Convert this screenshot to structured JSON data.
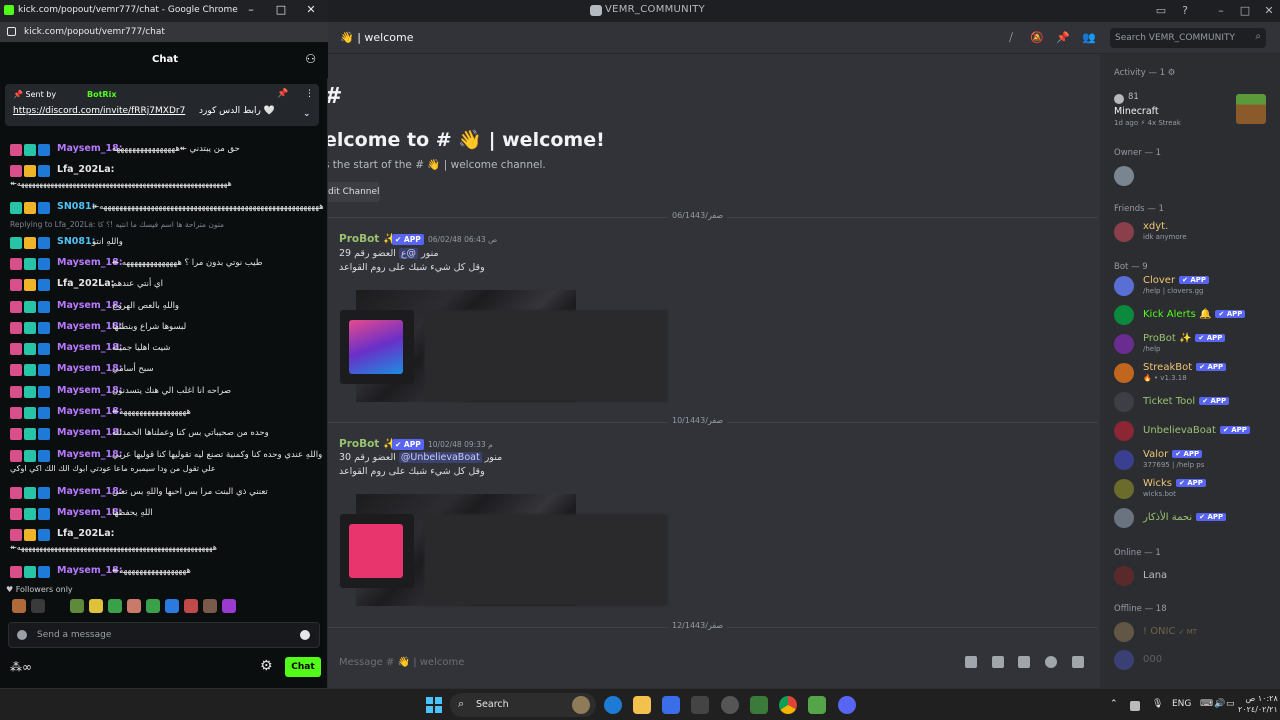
{
  "discord": {
    "window_title": "VEMR_COMMUNITY",
    "channel_header": "👋 | welcome",
    "search_placeholder": "Search VEMR_COMMUNITY",
    "welcome_title": "elcome to # 👋 | welcome!",
    "welcome_sub": "s the start of the # 👋 | welcome channel.",
    "edit_channel": "dit Channel",
    "dates": [
      "06/1443/صفر",
      "10/1443/صفر",
      "12/1443/صفر"
    ],
    "messages": [
      {
        "author": "ProBot ✨",
        "badge": "✔ APP",
        "time": "06/02/48 06:43 ص",
        "line1_prefix": "@ع",
        "line1": "العضو رقم 29",
        "line1_tail": "منور",
        "line2": "وقل كل شيء شبك على روم القواعد"
      },
      {
        "author": "ProBot ✨",
        "badge": "✔ APP",
        "time": "10/02/48 09:33 م",
        "line1": "العضو رقم 30",
        "mention": "@UnbelievaBoat",
        "line1_tail": "منور",
        "line2": "وقل كل شيء شبك على روم القواعد"
      }
    ],
    "composer_placeholder": "Message # 👋 | welcome",
    "members": {
      "activity_header": "Activity — 1 ⚙",
      "activity": {
        "count": "81",
        "game": "Minecraft",
        "meta": "1d ago",
        "streak": "⚡ 4x Streak"
      },
      "owner_header": "Owner — 1",
      "friends_header": "Friends — 1",
      "friend": {
        "name": "xdyt.",
        "status": "idk anymore"
      },
      "bot_header": "Bot — 9",
      "bots": [
        {
          "name": "Clover",
          "status": "/help | clovers.gg",
          "color": "#f0c674",
          "badge": "✔ APP"
        },
        {
          "name": "Kick Alerts 🔔",
          "status": "",
          "color": "#53fc18",
          "badge": "✔ APP"
        },
        {
          "name": "ProBot ✨",
          "status": "/help",
          "color": "#9ac26e",
          "badge": "✔ APP"
        },
        {
          "name": "StreakBot",
          "status": "🔥 • v1.3.18",
          "color": "#f0c674",
          "badge": "✔ APP"
        },
        {
          "name": "Ticket Tool",
          "status": "",
          "color": "#9ac26e",
          "badge": "✔ APP"
        },
        {
          "name": "UnbelievaBoat",
          "status": "",
          "color": "#9ac26e",
          "badge": "✔ APP"
        },
        {
          "name": "Valor",
          "status": "377695 | /help ps",
          "color": "#f0c674",
          "badge": "✔ APP"
        },
        {
          "name": "Wicks",
          "status": "wicks.bot",
          "color": "#f0c674",
          "badge": "✔ APP"
        },
        {
          "name": "نحمة الأذكار",
          "status": "",
          "color": "#9ac26e",
          "badge": "✔ APP"
        }
      ],
      "online_header": "Online — 1",
      "online": [
        {
          "name": "Lana"
        }
      ],
      "offline_header": "Offline — 18",
      "offline": [
        {
          "name": "! ONIC",
          "tag": "✓ MT"
        },
        {
          "name": "000"
        }
      ]
    }
  },
  "chrome": {
    "window_title": "kick.com/popout/vemr777/chat - Google Chrome",
    "url": "kick.com/popout/vemr777/chat"
  },
  "kick": {
    "header": "Chat",
    "pinned": {
      "sent_by": "Sent by",
      "bot": "BotRix",
      "link": "https://discord.com/invite/fRRj7MXDr7",
      "text": "رابط الدس كورد 🤍"
    },
    "messages": [
      {
        "user": "Maysem_18:",
        "color": "#b779ff",
        "text": "حق من يبتدني ↞ههههههههههههههههه"
      },
      {
        "user": "Lfa_202La:",
        "color": "#e6e6e6",
        "text": "",
        "line2": "↞هههههههههههههههههههههههههههههههههههههههههههههههههههههههههه"
      },
      {
        "user": "SN081:",
        "color": "#4fc3f7",
        "text": "↞ههههههههههههههههههههههههههههههههههههههههههههههههههههههههه"
      },
      {
        "user": "SN081:",
        "color": "#4fc3f7",
        "text": "واللهِ انتو"
      },
      {
        "user": "Maysem_18:",
        "color": "#b779ff",
        "text": "↞ طيب نوتي بدون مرا ؟ ههههههههههههههه"
      },
      {
        "user": "Lfa_202La:",
        "color": "#e6e6e6",
        "text": "اي أنتي عندهم"
      },
      {
        "user": "Maysem_18:",
        "color": "#b779ff",
        "text": "واللهِ بالعص الهروج"
      },
      {
        "user": "Maysem_18:",
        "color": "#b779ff",
        "text": "لبسوها شراع وبنطلها"
      },
      {
        "user": "Maysem_18:",
        "color": "#b779ff",
        "text": "شيت اهليا جميله"
      },
      {
        "user": "Maysem_18:",
        "color": "#b779ff",
        "text": "سبح أسامي"
      },
      {
        "user": "Maysem_18:",
        "color": "#b779ff",
        "text": "صراحه انا اغلب الي هنك يتسدنون"
      },
      {
        "user": "Maysem_18:",
        "color": "#b779ff",
        "text": "↞هههههههههههههههههه"
      },
      {
        "user": "Maysem_18:",
        "color": "#b779ff",
        "text": "وحده من صحيباتي بس كنا وعملناها الحمدلله"
      },
      {
        "user": "Maysem_18:",
        "color": "#b779ff",
        "text": "واللهِ عندي وحده كنا وكمنية تصنع ليه تقوليها كنا قوليها عربي",
        "line2": "علي تقول من ودا سيمبره ماعا عودتي ابوك الك الك اكي اوكي"
      },
      {
        "user": "Maysem_18:",
        "color": "#b779ff",
        "text": "تعنني ذي البنت مرا بس احبها واللهِ بس تعنن"
      },
      {
        "user": "Maysem_18:",
        "color": "#b779ff",
        "text": "اللهِ يحفظها"
      },
      {
        "user": "Lfa_202La:",
        "color": "#e6e6e6",
        "text": "",
        "line2": "↞هههههههههههههههههههههههههههههههههههههههههههههههههههههه"
      },
      {
        "user": "Maysem_18:",
        "color": "#b779ff",
        "text": "↞هههههههههههههههههه"
      }
    ],
    "reply_text": "Replying to Lfa_202La: متون متراحة ها اسم فيسك ما انتيه !؟ كا",
    "followers_only": "Followers only",
    "input_placeholder": "Send a message",
    "chat_button": "Chat",
    "bottom_icon": "∞"
  },
  "taskbar": {
    "search": "Search",
    "lang": "ENG",
    "time": "١٠:٢٨ ص",
    "date": "٢٠٢٤/٠٢/٢١"
  }
}
